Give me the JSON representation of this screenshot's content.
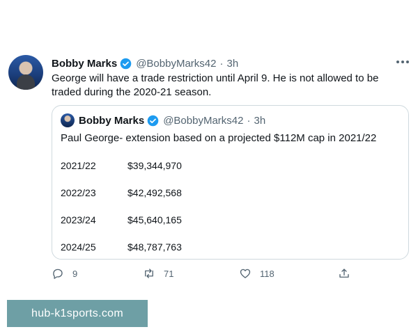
{
  "tweet": {
    "author_name": "Bobby Marks",
    "handle": "@BobbyMarks42",
    "separator": "·",
    "time": "3h",
    "text": "George will have a trade restriction until April 9. He is not allowed to be traded during the 2020-21 season."
  },
  "quoted": {
    "author_name": "Bobby Marks",
    "handle": "@BobbyMarks42",
    "separator": "·",
    "time": "3h",
    "text": "Paul George- extension based on a projected $112M cap in 2021/22",
    "rows": [
      {
        "season": "2021/22",
        "amount": "$39,344,970"
      },
      {
        "season": "2022/23",
        "amount": "$42,492,568"
      },
      {
        "season": "2023/24",
        "amount": "$45,640,165"
      },
      {
        "season": "2024/25",
        "amount": "$48,787,763"
      }
    ]
  },
  "actions": {
    "replies": "9",
    "retweets": "71",
    "likes": "118"
  },
  "icons": {
    "verified": "verified-badge-icon",
    "more": "more-options-icon",
    "reply": "reply-icon",
    "retweet": "retweet-icon",
    "like": "heart-icon",
    "share": "share-icon"
  },
  "colors": {
    "verified": "#1d9bf0",
    "muted": "#536471",
    "border": "#cfd9de",
    "watermark_bg": "#6e9fa5"
  },
  "watermark": "hub-k1sports.com"
}
